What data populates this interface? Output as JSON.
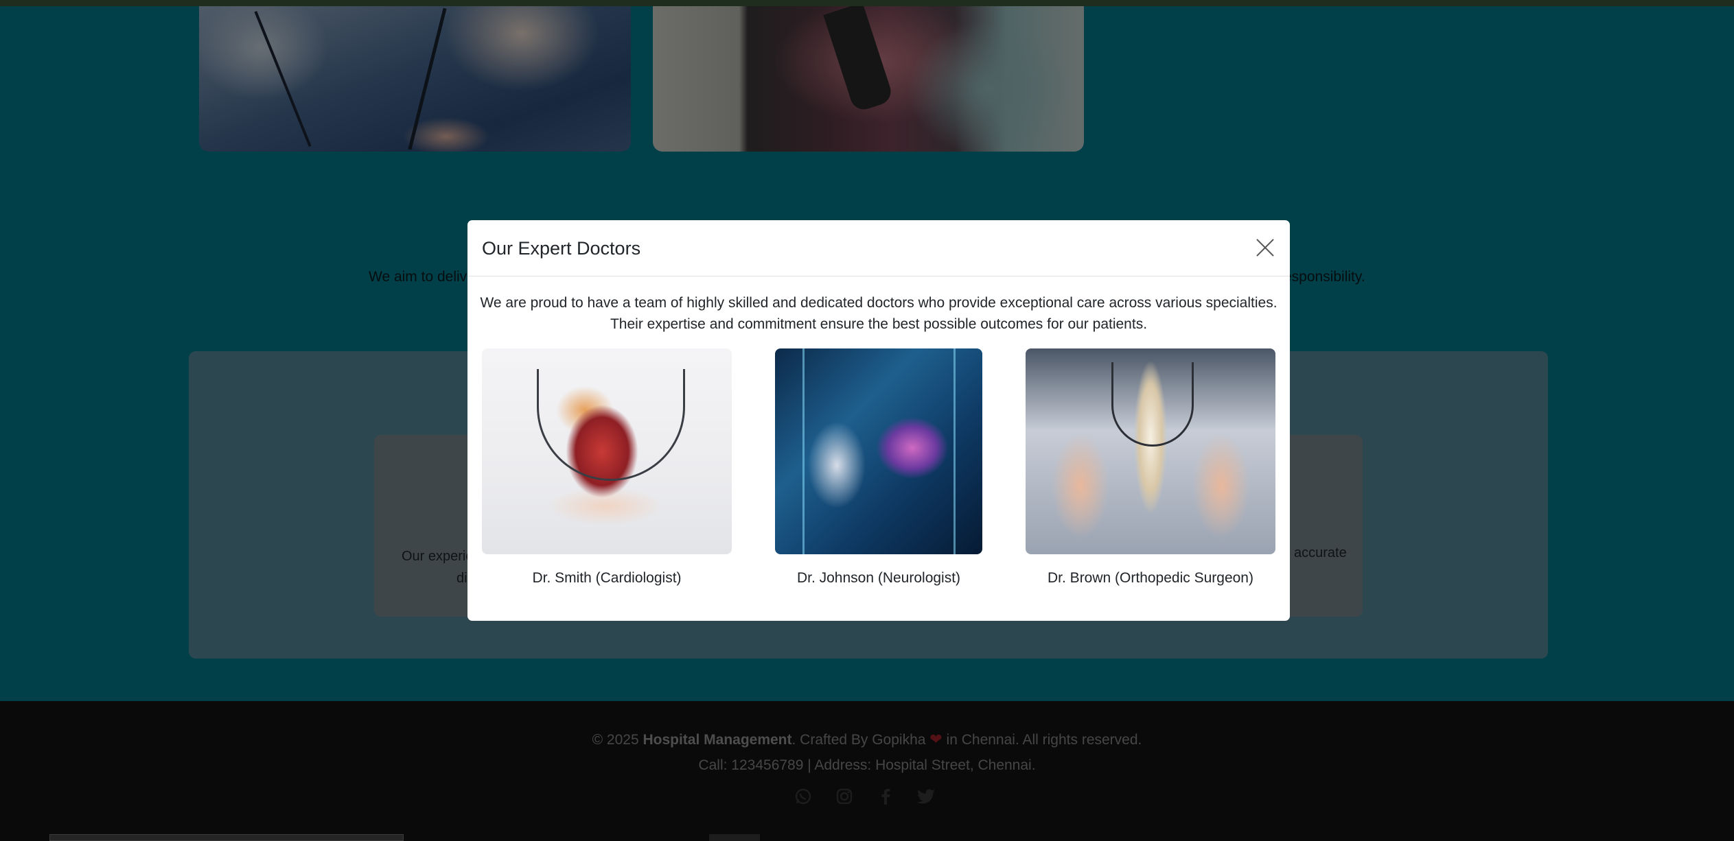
{
  "background": {
    "mission_text_left": "We aim to deliv",
    "mission_text_right": "esponsibility.",
    "services_text_left_line1": "Our experie",
    "services_text_left_line2": "di",
    "services_text_right": "accurate"
  },
  "modal": {
    "title": "Our Expert Doctors",
    "close_label": "×",
    "intro": "We are proud to have a team of highly skilled and dedicated doctors who provide exceptional care across various specialties. Their expertise and commitment ensure the best possible outcomes for our patients.",
    "doctors": [
      {
        "caption": "Dr. Smith (Cardiologist)",
        "image": "doctor-heart-image"
      },
      {
        "caption": "Dr. Johnson (Neurologist)",
        "image": "doctor-brain-image"
      },
      {
        "caption": "Dr. Brown (Orthopedic Surgeon)",
        "image": "doctor-spine-image"
      }
    ]
  },
  "footer": {
    "copyright_prefix": "© 2025 ",
    "brand": "Hospital Management",
    "crafted": ". Crafted By Gopikha ",
    "heart": "❤",
    "suffix": " in Chennai. All rights reserved.",
    "contact": "Call: 123456789 | Address: Hospital Street, Chennai.",
    "social_icons": [
      "whatsapp-icon",
      "instagram-icon",
      "facebook-icon",
      "twitter-icon"
    ]
  },
  "colors": {
    "page_bg": "#037f92",
    "footer_bg": "#141414",
    "modal_bg": "#ffffff",
    "heart": "#a8222c"
  }
}
